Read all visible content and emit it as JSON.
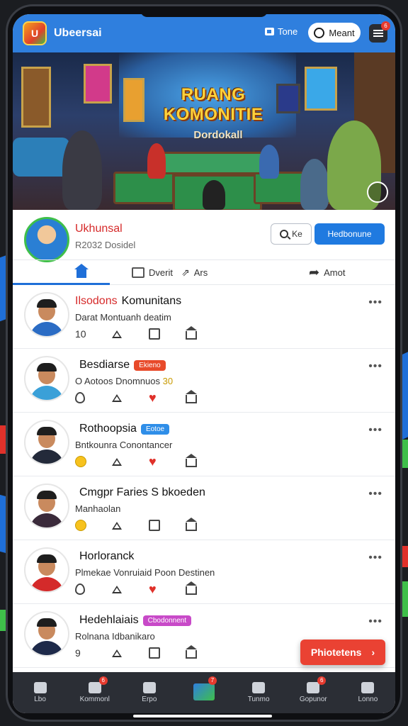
{
  "header": {
    "app_name": "Ubeersai",
    "toggle_label": "Tone",
    "button_label": "Meant",
    "menu_badge": "6",
    "colors": {
      "bar": "#2f7fde",
      "accent_red": "#e63a2e"
    }
  },
  "hero": {
    "title": "RUANG KOMONITIE",
    "subtitle": "Dordokall"
  },
  "profile": {
    "name": "Ukhunsal",
    "subtitle": "R2032 Dosidel",
    "search_label": "Ke",
    "primary_button": "Hedbonune"
  },
  "tabs": [
    {
      "label": "",
      "icon": "home-icon"
    },
    {
      "label": "Dverit",
      "icon": "message-icon"
    },
    {
      "label": "Ars",
      "icon": "share-icon"
    },
    {
      "label": "Amot",
      "icon": "forward-icon"
    }
  ],
  "posts": [
    {
      "title_accent": "Ilsodons",
      "title_rest": "Komunitans",
      "badge": "",
      "subtitle": "Darat Montuanh deatim",
      "count": "10",
      "actions": [
        "count",
        "triangle",
        "box",
        "house"
      ],
      "body_color": "#2b6cc4"
    },
    {
      "title_accent": "",
      "title_rest": "Besdiarse",
      "badge": "Ekieno",
      "badge_color": "#e84a2a",
      "subtitle": "O Aotoos Dnomnuos",
      "subtitle_emoji": "30",
      "count": "",
      "actions": [
        "drop",
        "triangle",
        "heart",
        "house"
      ],
      "body_color": "#3aa0d8"
    },
    {
      "title_accent": "",
      "title_rest": "Rothoopsia",
      "badge": "Eotoe",
      "badge_color": "#2f8ee8",
      "subtitle": "Bntkounra Conontancer",
      "count": "",
      "actions": [
        "smile",
        "triangle",
        "heart",
        "house"
      ],
      "body_color": "#232a3a"
    },
    {
      "title_accent": "",
      "title_rest": "Cmgpr Faries S bkoeden",
      "badge": "",
      "subtitle": "Manhaolan",
      "count": "",
      "actions": [
        "smile",
        "triangle",
        "box",
        "house"
      ],
      "body_color": "#3a2a3a"
    },
    {
      "title_accent": "",
      "title_rest": "Horloranck",
      "badge": "",
      "subtitle": "Plmekae Vonruiaid Poon Destinen",
      "count": "",
      "actions": [
        "drop",
        "triangle",
        "heart",
        "house"
      ],
      "body_color": "#d42a2a"
    },
    {
      "title_accent": "",
      "title_rest": "Hedehlaiais",
      "badge": "Cbodonnent",
      "badge_color": "#c84ac8",
      "subtitle": "Rolnana Idbanikaro",
      "count": "9",
      "actions": [
        "count",
        "triangle",
        "box",
        "house"
      ],
      "body_color": "#1e2a4a"
    }
  ],
  "fab": {
    "label": "Phiotetens"
  },
  "bottom_nav": [
    {
      "label": "Lbo",
      "icon": "home-icon",
      "badge": ""
    },
    {
      "label": "Kommonl",
      "icon": "edit-icon",
      "badge": "6"
    },
    {
      "label": "Erpo",
      "icon": "search-icon",
      "badge": ""
    },
    {
      "label": "",
      "icon": "create-icon",
      "badge": "7"
    },
    {
      "label": "Tunmo",
      "icon": "chat-icon",
      "badge": ""
    },
    {
      "label": "Gopunor",
      "icon": "notification-icon",
      "badge": "6"
    },
    {
      "label": "Lonno",
      "icon": "profile-icon",
      "badge": ""
    }
  ]
}
